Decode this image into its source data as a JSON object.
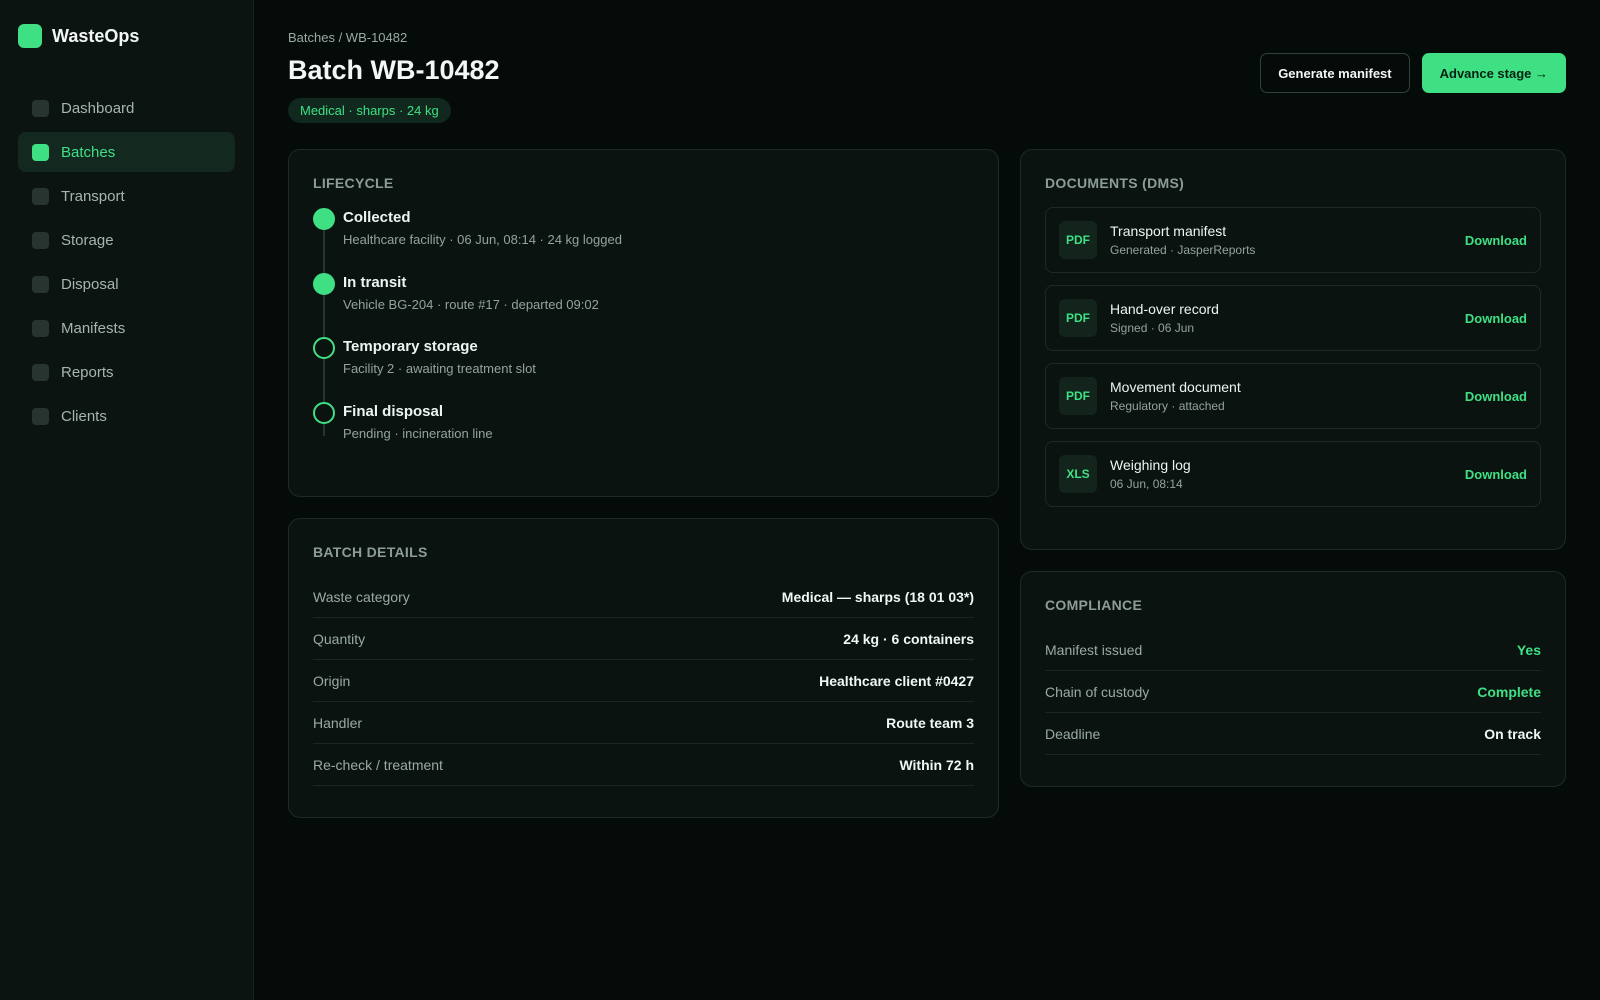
{
  "brand": {
    "name": "WasteOps"
  },
  "sidebar": {
    "items": [
      {
        "label": "Dashboard",
        "icon": "square-icon"
      },
      {
        "label": "Batches",
        "icon": "square-icon",
        "active": true
      },
      {
        "label": "Transport",
        "icon": "square-icon"
      },
      {
        "label": "Storage",
        "icon": "square-icon"
      },
      {
        "label": "Disposal",
        "icon": "square-icon"
      },
      {
        "label": "Manifests",
        "icon": "square-icon"
      },
      {
        "label": "Reports",
        "icon": "square-icon"
      },
      {
        "label": "Clients",
        "icon": "square-icon"
      }
    ]
  },
  "header": {
    "breadcrumb": "Batches / WB-10482",
    "title": "Batch WB-10482",
    "tag": "Medical · sharps · 24 kg",
    "actions": {
      "secondary": "Generate manifest",
      "primary": "Advance stage →"
    }
  },
  "lifecycle": {
    "title": "LIFECYCLE",
    "steps": [
      {
        "title": "Collected",
        "desc": "Healthcare facility · 06 Jun, 08:14 · 24 kg logged",
        "done": true
      },
      {
        "title": "In transit",
        "desc": "Vehicle BG-204 · route #17 · departed 09:02",
        "done": true
      },
      {
        "title": "Temporary storage",
        "desc": "Facility 2 · awaiting treatment slot",
        "done": false
      },
      {
        "title": "Final disposal",
        "desc": "Pending · incineration line",
        "done": false
      }
    ]
  },
  "details": {
    "title": "BATCH DETAILS",
    "rows": [
      {
        "key": "Waste category",
        "value": "Medical — sharps (18 01 03*)"
      },
      {
        "key": "Quantity",
        "value": "24 kg · 6 containers"
      },
      {
        "key": "Origin",
        "value": "Healthcare client #0427"
      },
      {
        "key": "Handler",
        "value": "Route team 3"
      },
      {
        "key": "Re-check / treatment",
        "value": "Within 72 h"
      }
    ]
  },
  "documents": {
    "title": "DOCUMENTS (DMS)",
    "items": [
      {
        "type": "PDF",
        "name": "Transport manifest",
        "meta": "Generated · JasperReports",
        "action": "Download"
      },
      {
        "type": "PDF",
        "name": "Hand-over record",
        "meta": "Signed · 06 Jun",
        "action": "Download"
      },
      {
        "type": "PDF",
        "name": "Movement document",
        "meta": "Regulatory · attached",
        "action": "Download"
      },
      {
        "type": "XLS",
        "name": "Weighing log",
        "meta": "06 Jun, 08:14",
        "action": "Download"
      }
    ]
  },
  "compliance": {
    "title": "COMPLIANCE",
    "rows": [
      {
        "key": "Manifest issued",
        "value": "Yes",
        "accent": true
      },
      {
        "key": "Chain of custody",
        "value": "Complete",
        "accent": true
      },
      {
        "key": "Deadline",
        "value": "On track",
        "accent": false
      }
    ]
  },
  "colors": {
    "accent": "#3fe083",
    "background": "#050b09",
    "sidebar": "#0b1411",
    "card": "#0b1311"
  }
}
